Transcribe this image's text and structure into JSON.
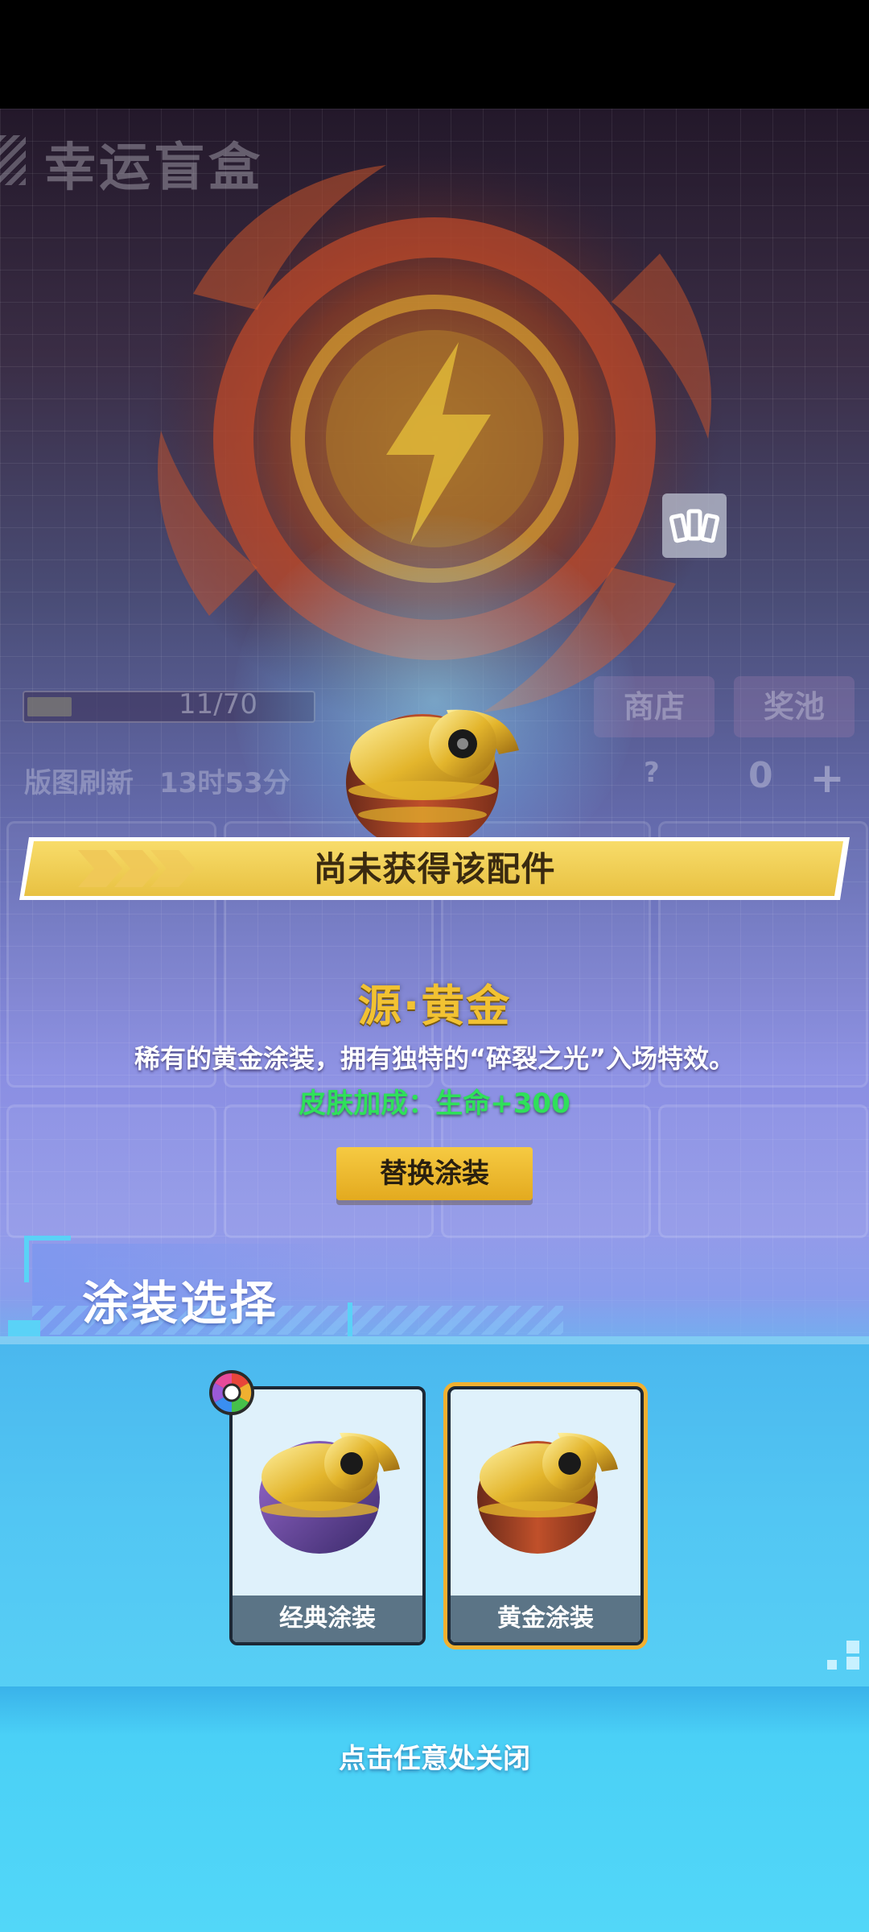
{
  "background": {
    "title": "幸运盲盒",
    "progress_text": "11/70",
    "progress": 0.157,
    "tabs": [
      "商店",
      "奖池"
    ],
    "refresh_label": "版图刷新",
    "refresh_time": "13时53分",
    "help": "?",
    "count": "0",
    "plus": "+"
  },
  "popup": {
    "status_banner": "尚未获得该配件",
    "item_name": "源·黄金",
    "description": "稀有的黄金涂装，拥有独特的“碎裂之光”入场特效。",
    "bonus": "皮肤加成：生命+300",
    "replace_button": "替换涂装",
    "share_icon": "share-icon"
  },
  "skin_panel": {
    "title": "涂装选择",
    "skins": [
      {
        "label": "经典涂装",
        "selected": false,
        "has_color_badge": true
      },
      {
        "label": "黄金涂装",
        "selected": true,
        "has_color_badge": false
      }
    ]
  },
  "close_hint": "点击任意处关闭",
  "colors": {
    "gold": "#f2c232",
    "bonus_green": "#2fe05a",
    "panel_blue": "#52c6f3",
    "selected_border": "#f0b030"
  }
}
